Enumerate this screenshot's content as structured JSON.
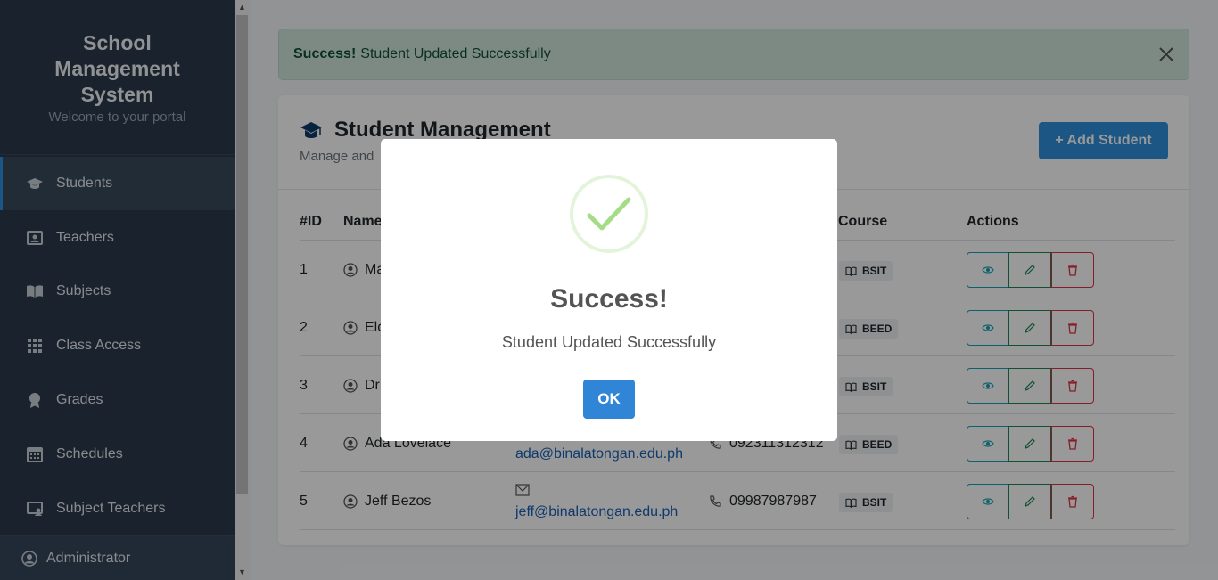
{
  "sidebar": {
    "title_line1": "School",
    "title_line2": "Management",
    "title_line3": "System",
    "subtitle": "Welcome to your portal",
    "items": [
      {
        "label": "Students",
        "icon": "graduation-cap-icon",
        "active": true
      },
      {
        "label": "Teachers",
        "icon": "teacher-board-icon"
      },
      {
        "label": "Subjects",
        "icon": "book-open-icon"
      },
      {
        "label": "Class Access",
        "icon": "grid-icon"
      },
      {
        "label": "Grades",
        "icon": "award-icon"
      },
      {
        "label": "Schedules",
        "icon": "calendar-icon"
      },
      {
        "label": "Subject Teachers",
        "icon": "presentation-icon"
      }
    ],
    "user": "Administrator"
  },
  "alert": {
    "strong": "Success!",
    "message": "Student Updated Successfully"
  },
  "header": {
    "title": "Student Management",
    "subtitle": "Manage and",
    "add_button": "+ Add Student"
  },
  "table": {
    "columns": [
      "#ID",
      "Name",
      "Course",
      "Actions"
    ],
    "rows": [
      {
        "id": "1",
        "name": "Ma",
        "email": "",
        "phone": "",
        "course": "BSIT"
      },
      {
        "id": "2",
        "name": "Elo",
        "email": "",
        "phone": "",
        "course": "BEED"
      },
      {
        "id": "3",
        "name": "Dr",
        "email": "",
        "phone": "",
        "course": "BSIT"
      },
      {
        "id": "4",
        "name": "Ada Lovelace",
        "email": "ada@binalatongan.edu.ph",
        "phone": "092311312312",
        "course": "BEED"
      },
      {
        "id": "5",
        "name": "Jeff Bezos",
        "email": "jeff@binalatongan.edu.ph",
        "phone": "09987987987",
        "course": "BSIT"
      }
    ]
  },
  "modal": {
    "title": "Success!",
    "text": "Student Updated Successfully",
    "ok": "OK"
  },
  "colors": {
    "sidebar": "#2b3a4b",
    "accent": "#2d8fdc",
    "success_check": "#a5dc86",
    "ok_button": "#3085d6"
  }
}
